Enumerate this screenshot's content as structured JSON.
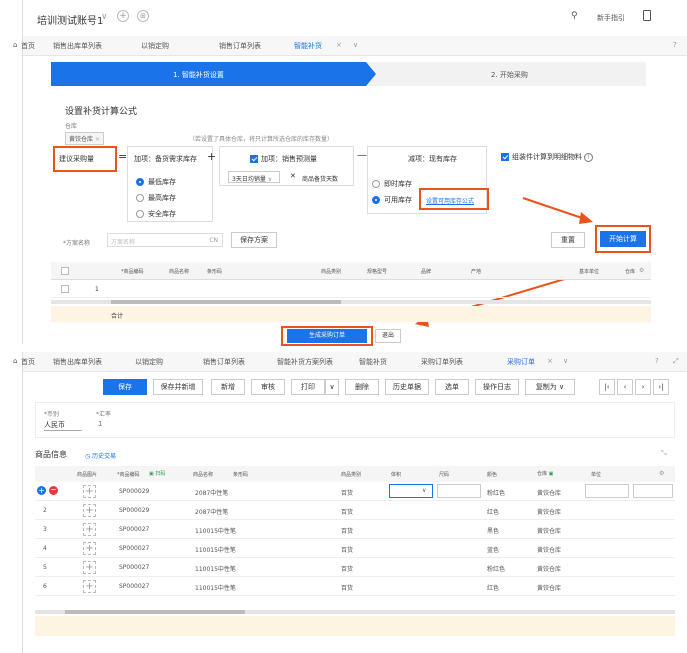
{
  "panel1": {
    "account": "培训测试账号1",
    "help_label": "新手指引",
    "tabs": [
      {
        "label": "首页",
        "active": false
      },
      {
        "label": "销售出库单列表",
        "active": false
      },
      {
        "label": "以销定购",
        "active": false
      },
      {
        "label": "销售订单列表",
        "active": false
      },
      {
        "label": "智能补货",
        "active": true
      }
    ],
    "steps": {
      "step1": "1. 智能补货设置",
      "step2": "2. 开始采购"
    },
    "formula_title": "设置补货计算公式",
    "warehouse_label": "仓库",
    "warehouse_tag": "黄饺仓库",
    "warehouse_hint": "（若设置了具体仓库，将只计算所选仓库的库存数量）",
    "suggest_label": "建议采购量",
    "equals": "=",
    "plus": "+",
    "minus": "—",
    "times": "✕",
    "add_label": "加项：备货需求库存",
    "radios_left": [
      {
        "label": "最低库存",
        "selected": true
      },
      {
        "label": "最高库存",
        "selected": false
      },
      {
        "label": "安全库存",
        "selected": false
      }
    ],
    "add_sales_label": "加项：销售预测量",
    "days_select": "3天日均销量",
    "stock_days": "商品备货天数",
    "sub_label": "减项：现有库存",
    "radios_right": [
      {
        "label": "即时库存",
        "selected": false
      },
      {
        "label": "可用库存",
        "selected": true
      }
    ],
    "set_available_link": "设置可用库存公式",
    "combo_label": "组装件计算到明细物料",
    "scheme_label": "*方案名称",
    "scheme_placeholder": "方案名称",
    "scheme_cn": "CN",
    "save_scheme": "保存方案",
    "reset": "重置",
    "start_calc": "开始计算",
    "table_headers": [
      "*商品编码",
      "商品名称",
      "条形码",
      "商品类别",
      "规格型号",
      "品牌",
      "产地",
      "基本单位",
      "仓库"
    ],
    "row_num": "1",
    "total_label": "合计",
    "gen_order": "生成采购订单",
    "exit": "退出"
  },
  "panel2": {
    "tabs": [
      {
        "label": "首页",
        "active": false
      },
      {
        "label": "销售出库单列表",
        "active": false
      },
      {
        "label": "以销定购",
        "active": false
      },
      {
        "label": "销售订单列表",
        "active": false
      },
      {
        "label": "智能补货方案列表",
        "active": false
      },
      {
        "label": "智能补货",
        "active": false
      },
      {
        "label": "采购订单列表",
        "active": false
      },
      {
        "label": "采购订单",
        "active": true
      }
    ],
    "toolbar": {
      "save": "保存",
      "save_new": "保存并新增",
      "new": "新增",
      "audit": "审核",
      "print": "打印",
      "delete": "删除",
      "history": "历史单据",
      "select_source": "选单",
      "oplog": "操作日志",
      "copy_as": "复制为"
    },
    "currency_label": "*币别",
    "currency_value": "人民币",
    "rate_label": "*汇率",
    "rate_value": "1",
    "section_title": "商品信息",
    "history_link": "历史交易",
    "headers": {
      "image": "商品图片",
      "code": "*商品编码",
      "scan": "扫码",
      "name": "商品名称",
      "barcode": "条形码",
      "category": "商品类别",
      "volume": "体积",
      "size": "尺码",
      "color": "颜色",
      "warehouse": "仓库",
      "unit": "单位"
    },
    "rows": [
      {
        "num": "",
        "code": "SP000029",
        "name": "2087中性笔",
        "category": "百货",
        "color": "粉红色",
        "warehouse": "黄饺仓库"
      },
      {
        "num": "2",
        "code": "SP000029",
        "name": "2087中性笔",
        "category": "百货",
        "color": "红色",
        "warehouse": "黄饺仓库"
      },
      {
        "num": "3",
        "code": "SP000027",
        "name": "110015中性笔",
        "category": "百货",
        "color": "黑色",
        "warehouse": "黄饺仓库"
      },
      {
        "num": "4",
        "code": "SP000027",
        "name": "110015中性笔",
        "category": "百货",
        "color": "蓝色",
        "warehouse": "黄饺仓库"
      },
      {
        "num": "5",
        "code": "SP000027",
        "name": "110015中性笔",
        "category": "百货",
        "color": "粉红色",
        "warehouse": "黄饺仓库"
      },
      {
        "num": "6",
        "code": "SP000027",
        "name": "110015中性笔",
        "category": "百货",
        "color": "红色",
        "warehouse": "黄饺仓库"
      }
    ]
  },
  "colors": {
    "accent": "#1a73e8",
    "highlight": "#e8541a",
    "step_active": "#1a73e8"
  }
}
